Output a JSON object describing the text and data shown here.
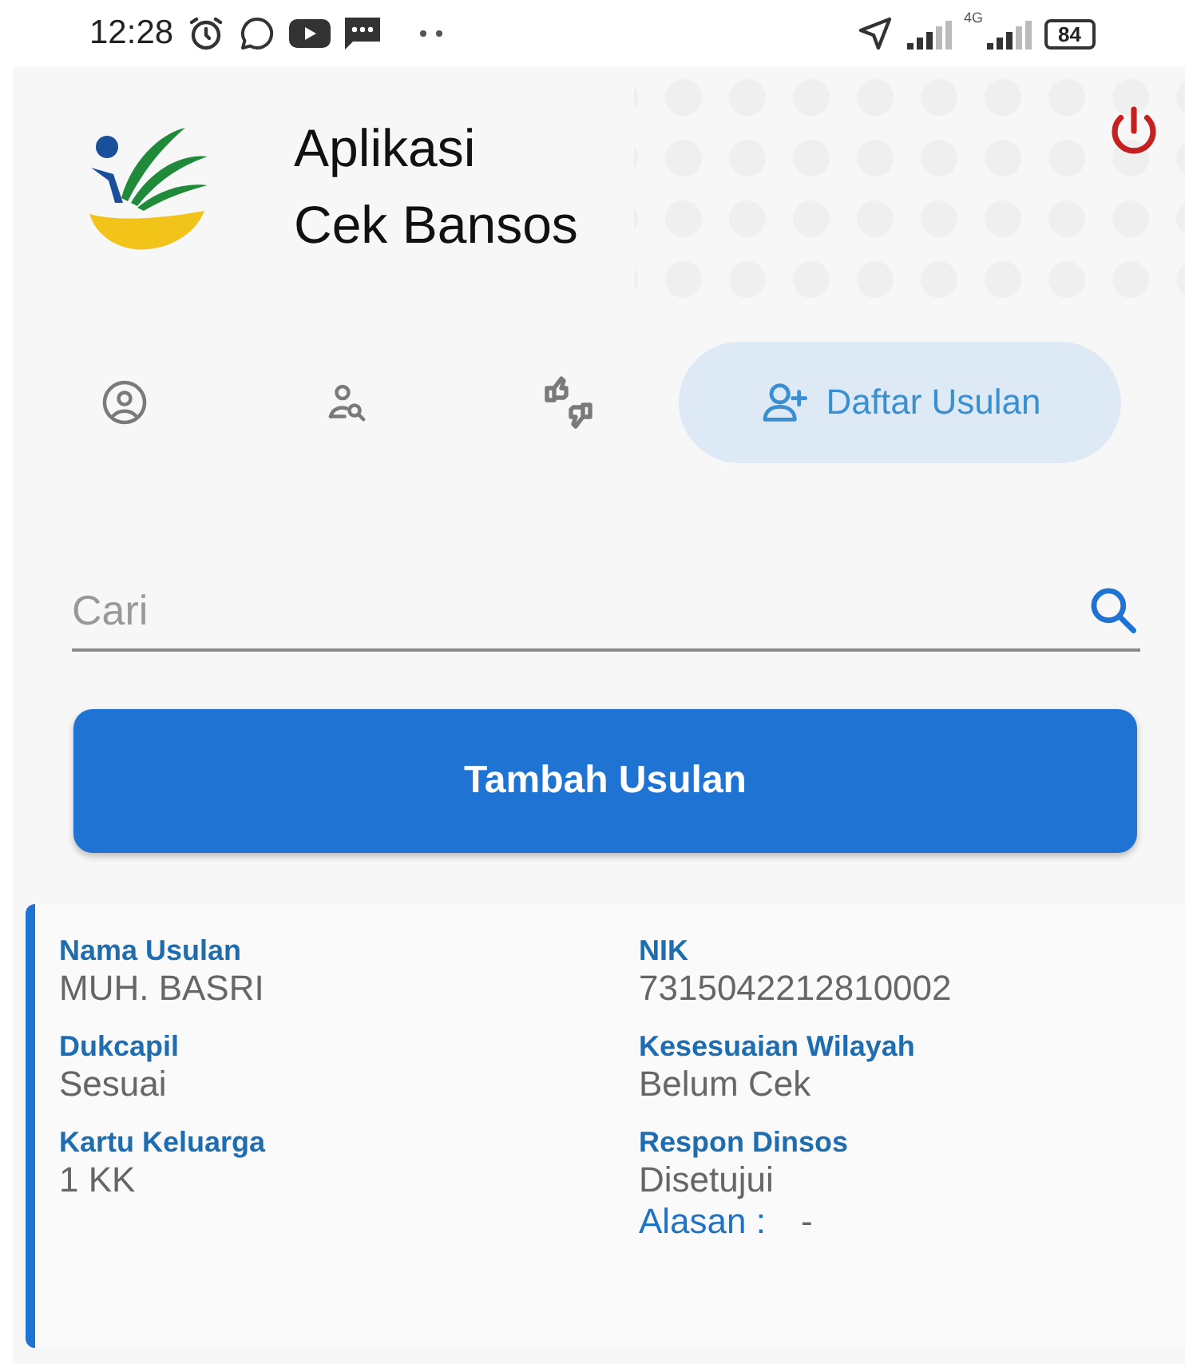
{
  "status_bar": {
    "time": "12:28",
    "network": "4G",
    "battery": "84"
  },
  "app": {
    "title_lines": [
      "Aplikasi",
      "Cek Bansos"
    ]
  },
  "tabs": [
    {
      "kind": "profile",
      "selected": false
    },
    {
      "kind": "search-person",
      "selected": false
    },
    {
      "kind": "thumbs",
      "selected": false
    },
    {
      "kind": "add-person",
      "label": "Daftar Usulan",
      "selected": true
    }
  ],
  "search": {
    "placeholder": "Cari"
  },
  "add_button": {
    "label": "Tambah Usulan"
  },
  "cards": [
    {
      "left": [
        {
          "label": "Nama Usulan",
          "value": "MUH. BASRI"
        },
        {
          "label": "Dukcapil",
          "value": "Sesuai"
        },
        {
          "label": "Kartu Keluarga",
          "value": "1 KK"
        }
      ],
      "right": [
        {
          "label": "NIK",
          "value": "7315042212810002"
        },
        {
          "label": "Kesesuaian Wilayah",
          "value": "Belum Cek"
        },
        {
          "label": "Respon Dinsos",
          "value": "Disetujui"
        }
      ],
      "reason": {
        "label": "Alasan :",
        "value": "-"
      }
    }
  ]
}
